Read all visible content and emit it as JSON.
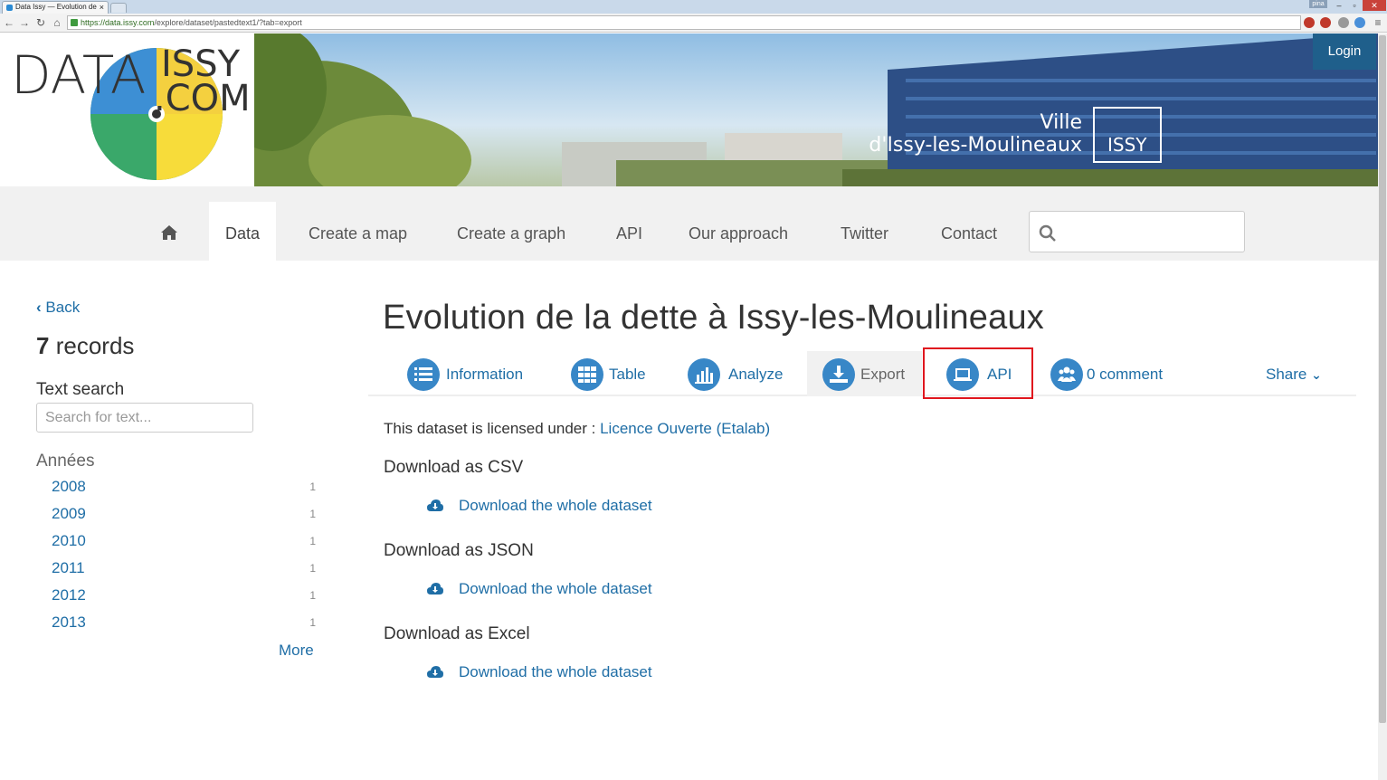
{
  "browser": {
    "tab_title": "Data Issy — Evolution de",
    "url_host": "https://data.issy.com",
    "url_path": "/explore/dataset/pastedtext1/?tab=export",
    "profile": "pina"
  },
  "header": {
    "logo_text_left": "DATA",
    "logo_text_right_1": "ISSY",
    "logo_text_right_2": ".COM",
    "banner_line1": "Ville",
    "banner_line2": "d'Issy-les-Moulineaux",
    "banner_mark": "ISSY",
    "login": "Login"
  },
  "nav": {
    "items": [
      "Data",
      "Create a map",
      "Create a graph",
      "API",
      "Our approach",
      "Twitter",
      "Contact"
    ],
    "search_placeholder": ""
  },
  "sidebar": {
    "back": "Back",
    "records_count": "7",
    "records_label": "records",
    "text_search_label": "Text search",
    "text_search_placeholder": "Search for text...",
    "facet_title": "Années",
    "facets": [
      {
        "label": "2008",
        "count": "1"
      },
      {
        "label": "2009",
        "count": "1"
      },
      {
        "label": "2010",
        "count": "1"
      },
      {
        "label": "2011",
        "count": "1"
      },
      {
        "label": "2012",
        "count": "1"
      },
      {
        "label": "2013",
        "count": "1"
      }
    ],
    "more": "More"
  },
  "main": {
    "title": "Evolution de la dette à Issy-les-Moulineaux",
    "tabs": [
      {
        "label": "Information",
        "icon": "list-icon"
      },
      {
        "label": "Table",
        "icon": "grid-icon"
      },
      {
        "label": "Analyze",
        "icon": "chart-icon"
      },
      {
        "label": "Export",
        "icon": "download-icon"
      },
      {
        "label": "API",
        "icon": "laptop-icon"
      },
      {
        "label": "0 comment",
        "icon": "users-icon"
      }
    ],
    "share": "Share",
    "license_text": "This dataset is licensed under :",
    "license_link": "Licence Ouverte (Etalab)",
    "downloads": [
      {
        "title": "Download as CSV",
        "link": "Download the whole dataset"
      },
      {
        "title": "Download as JSON",
        "link": "Download the whole dataset"
      },
      {
        "title": "Download as Excel",
        "link": "Download the whole dataset"
      }
    ]
  },
  "colors": {
    "accent": "#1f6ea6",
    "icon_bg": "#3887c7",
    "login_bg": "#1f5f8b",
    "highlight": "#e0161e"
  }
}
